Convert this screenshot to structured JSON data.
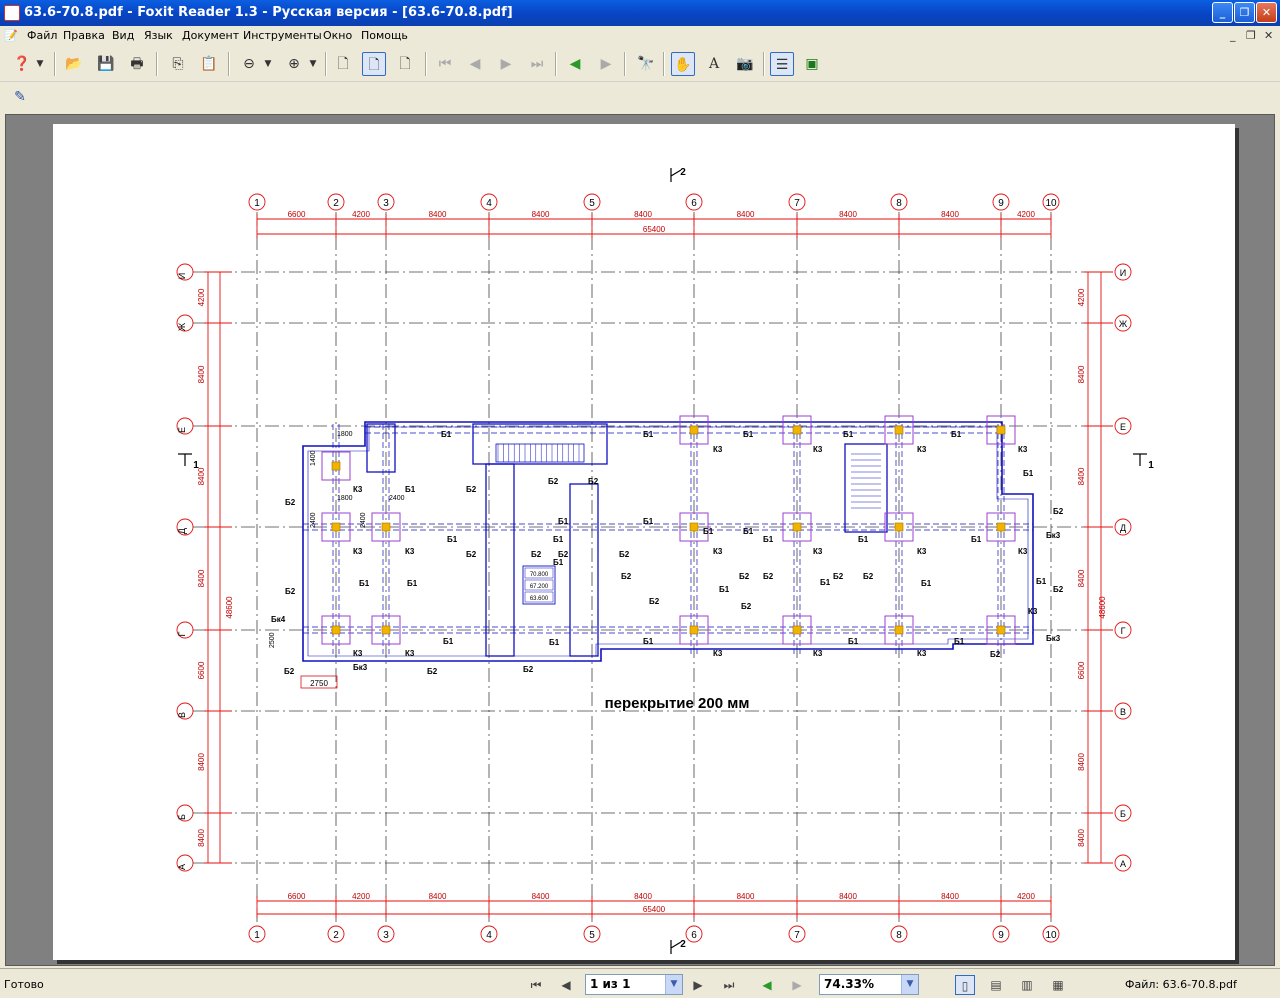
{
  "window": {
    "title": "63.6-70.8.pdf - Foxit Reader 1.3 - Русская версия  - [63.6-70.8.pdf]"
  },
  "menu": {
    "items": [
      "Файл",
      "Правка",
      "Вид",
      "Язык",
      "Документ",
      "Инструменты",
      "Окно",
      "Помощь"
    ]
  },
  "icons": {
    "toolbar": [
      "help-icon",
      "open-icon",
      "save-icon",
      "print-icon",
      "copy-icon",
      "paste-icon",
      "zoom-out-icon",
      "zoom-in-icon",
      "single-page-icon",
      "continuous-page-icon",
      "facing-page-icon",
      "first-page-icon",
      "prev-page-icon",
      "next-page-icon",
      "last-page-icon",
      "back-icon",
      "forward-icon",
      "find-icon",
      "hand-tool-icon",
      "text-select-icon",
      "snapshot-icon",
      "bookmarks-icon",
      "thumbnails-icon"
    ]
  },
  "status": {
    "ready": "Готово",
    "page_input": "1 из 1",
    "zoom": "74.33%",
    "file": "Файл: 63.6-70.8.pdf"
  },
  "drawing": {
    "col_labels": [
      "1",
      "2",
      "3",
      "4",
      "5",
      "6",
      "7",
      "8",
      "9",
      "10"
    ],
    "row_labels": [
      "И",
      "Ж",
      "Е",
      "Д",
      "Г",
      "В",
      "Б",
      "А"
    ],
    "col_dims": [
      "6600",
      "4200",
      "8400",
      "8400",
      "8400",
      "8400",
      "8400",
      "8400",
      "4200"
    ],
    "total_width": "65400",
    "row_dims": [
      "4200",
      "8400",
      "8400",
      "8400",
      "6600",
      "8400",
      "8400",
      "4200"
    ],
    "total_height": "48600",
    "section_mark": "2",
    "section_mark_side": "1",
    "caption": "перекрытие 200 мм",
    "levels": [
      "70.800",
      "67.200",
      "63.600"
    ],
    "beam_labels": {
      "b1": "Б1",
      "b2": "Б2",
      "k3": "К3",
      "bk3": "Бк3",
      "bk4": "Бк4"
    },
    "local_dims": [
      "1800",
      "1800",
      "2400",
      "2400",
      "2400",
      "1400",
      "2500",
      "2750"
    ]
  }
}
